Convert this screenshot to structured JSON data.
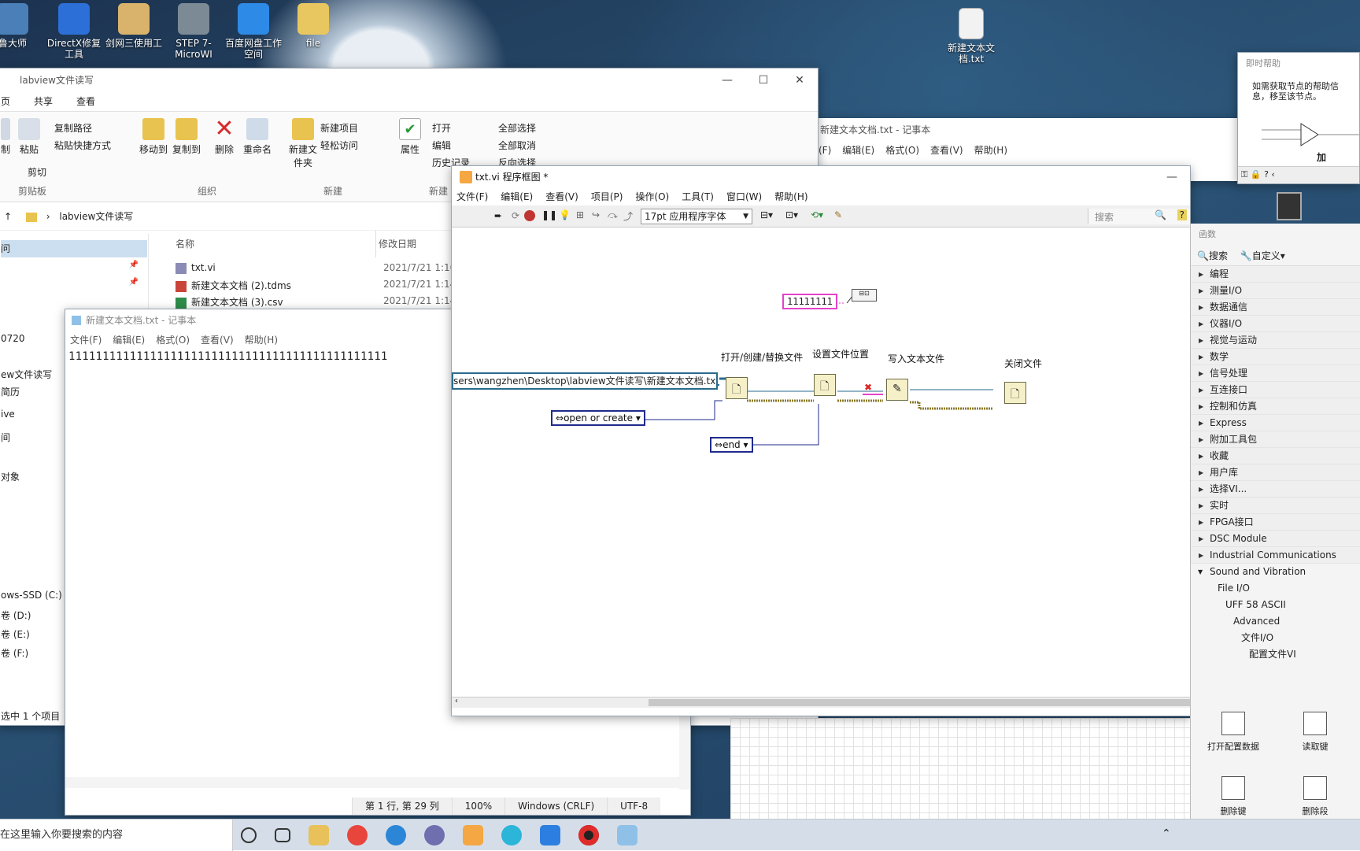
{
  "desktop": {
    "icons": [
      {
        "label": "鲁大师",
        "color": "#4a7fb8"
      },
      {
        "label": "DirectX修复工具",
        "color": "#2c6fd6"
      },
      {
        "label": "剑网三使用工",
        "color": "#d9b36b"
      },
      {
        "label": "STEP 7-MicroWI",
        "color": "#7c8a96"
      },
      {
        "label": "百度网盘工作空间",
        "color": "#2d8ae6"
      },
      {
        "label": "file",
        "color": "#e8c760"
      },
      {
        "label": "新建文本文档.txt",
        "color": "#f2f2f2"
      }
    ]
  },
  "explorer": {
    "title": "labview文件读写",
    "tabs": [
      "页",
      "共享",
      "查看"
    ],
    "ribbon": {
      "clipboard": {
        "group": "剪贴板",
        "items": [
          "制",
          "粘贴",
          "复制路径",
          "粘贴快捷方式",
          "剪切"
        ]
      },
      "organize": {
        "group": "组织",
        "items": [
          "移动到",
          "复制到",
          "删除",
          "重命名"
        ]
      },
      "new": {
        "group": "新建",
        "items": [
          "新建文件夹",
          "新建项目",
          "轻松访问"
        ]
      },
      "open": {
        "group": "打开",
        "items": [
          "属性",
          "打开",
          "编辑",
          "历史记录"
        ]
      },
      "select": {
        "items": [
          "全部选择",
          "全部取消",
          "反向选择"
        ]
      }
    },
    "address": "labview文件读写",
    "columns": {
      "name": "名称",
      "modified": "修改日期"
    },
    "files": [
      {
        "name": "txt.vi",
        "date": "2021/7/21 1:16"
      },
      {
        "name": "新建文本文档 (2).tdms",
        "date": "2021/7/21 1:14"
      },
      {
        "name": "新建文本文档 (3).csv",
        "date": "2021/7/21 1:14"
      }
    ],
    "sidebar": [
      "问",
      "0720",
      "ew文件读写",
      "简历",
      "ive",
      "间",
      "对象",
      "ows-SSD (C:)",
      "卷 (D:)",
      "卷 (E:)",
      "卷 (F:)"
    ],
    "status": "选中 1 个项目"
  },
  "notepad_bg": {
    "title": "新建文本文档.txt - 记事本",
    "menu": [
      "(F)",
      "编辑(E)",
      "格式(O)",
      "查看(V)",
      "帮助(H)"
    ]
  },
  "notepad": {
    "title": "新建文本文档.txt - 记事本",
    "menu": [
      "文件(F)",
      "编辑(E)",
      "格式(O)",
      "查看(V)",
      "帮助(H)"
    ],
    "content": "11111111111111111111111111111111111111111111111",
    "status": {
      "position": "第 1 行, 第 29 列",
      "zoom": "100%",
      "eol": "Windows (CRLF)",
      "encoding": "UTF-8"
    }
  },
  "labview": {
    "title": "txt.vi 程序框图 *",
    "menu": [
      "文件(F)",
      "编辑(E)",
      "查看(V)",
      "项目(P)",
      "操作(O)",
      "工具(T)",
      "窗口(W)",
      "帮助(H)"
    ],
    "font_selector": "17pt 应用程序字体",
    "search_placeholder": "搜索",
    "string_constant": "11111111",
    "path_constant": "sers\\wangzhen\\Desktop\\labview文件读写\\新建文本文档.txt",
    "nodes": {
      "open": "打开/创建/替换文件",
      "set_pos": "设置文件位置",
      "write": "写入文本文件",
      "close": "关闭文件"
    },
    "enum_open": "open or create",
    "enum_end": "end"
  },
  "context_help": {
    "title": "即时帮助",
    "text": "如需获取节点的帮助信息，移至该节点。",
    "node_label": "加"
  },
  "functions_palette": {
    "title": "函数",
    "search": "搜索",
    "customize": "自定义▾",
    "categories": [
      "编程",
      "测量I/O",
      "数据通信",
      "仪器I/O",
      "视觉与运动",
      "数学",
      "信号处理",
      "互连接口",
      "控制和仿真",
      "Express",
      "附加工具包",
      "收藏",
      "用户库",
      "选择VI...",
      "实时",
      "FPGA接口",
      "DSC Module",
      "Industrial Communications"
    ],
    "expanded": "Sound and Vibration",
    "tree": [
      "File I/O",
      "UFF 58 ASCII",
      "Advanced",
      "文件I/O",
      "配置文件VI"
    ],
    "vis": [
      "打开配置数据",
      "读取键",
      "删除键",
      "删除段"
    ]
  },
  "taskbar": {
    "search_placeholder": "在这里输入你要搜索的内容",
    "apps": [
      {
        "name": "cortana-icon",
        "color": "#ffffff"
      },
      {
        "name": "taskview-icon",
        "color": "#ffffff"
      },
      {
        "name": "explorer-icon",
        "color": "#e8c15a"
      },
      {
        "name": "chrome-icon",
        "color": "#e8453c"
      },
      {
        "name": "edge-icon",
        "color": "#2c86d8"
      },
      {
        "name": "labview-icon",
        "color": "#6f6fb0"
      },
      {
        "name": "media-icon",
        "color": "#f4a742"
      },
      {
        "name": "app-icon",
        "color": "#2bb5d8"
      },
      {
        "name": "kuwo-icon",
        "color": "#2c7fe0"
      },
      {
        "name": "record-icon",
        "color": "#e02b2b"
      },
      {
        "name": "notepad-icon",
        "color": "#8fc1e8"
      }
    ]
  }
}
